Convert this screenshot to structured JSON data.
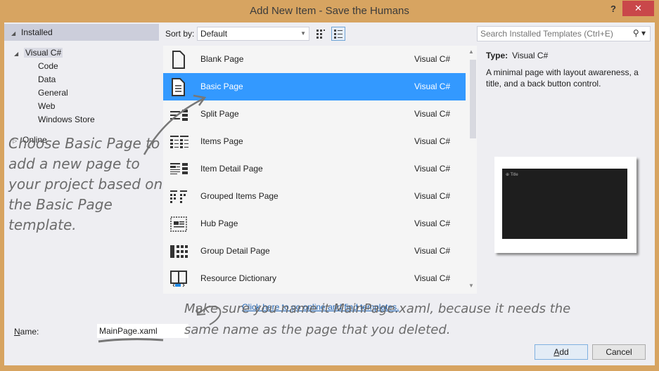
{
  "window": {
    "title": "Add New Item - Save the Humans",
    "help_label": "?",
    "close_label": "✕"
  },
  "tree": {
    "installed": "Installed",
    "visual_csharp": "Visual C#",
    "children": [
      "Code",
      "Data",
      "General",
      "Web",
      "Windows Store"
    ],
    "online": "Online"
  },
  "toolbar": {
    "sort_label": "Sort by:",
    "sort_value": "Default",
    "search_placeholder": "Search Installed Templates (Ctrl+E)"
  },
  "templates": [
    {
      "name": "Blank Page",
      "lang": "Visual C#",
      "icon": "blank-page-icon"
    },
    {
      "name": "Basic Page",
      "lang": "Visual C#",
      "icon": "basic-page-icon",
      "selected": true
    },
    {
      "name": "Split Page",
      "lang": "Visual C#",
      "icon": "split-page-icon"
    },
    {
      "name": "Items Page",
      "lang": "Visual C#",
      "icon": "items-page-icon"
    },
    {
      "name": "Item Detail Page",
      "lang": "Visual C#",
      "icon": "item-detail-page-icon"
    },
    {
      "name": "Grouped Items Page",
      "lang": "Visual C#",
      "icon": "grouped-items-page-icon"
    },
    {
      "name": "Hub Page",
      "lang": "Visual C#",
      "icon": "hub-page-icon"
    },
    {
      "name": "Group Detail Page",
      "lang": "Visual C#",
      "icon": "group-detail-page-icon"
    },
    {
      "name": "Resource Dictionary",
      "lang": "Visual C#",
      "icon": "resource-dictionary-icon"
    }
  ],
  "details": {
    "type_label": "Type:",
    "type_value": "Visual C#",
    "description": "A minimal page with layout awareness, a title, and a back button control.",
    "preview_title": "Title"
  },
  "online_link": "Click here to go online and find templates.",
  "name_field": {
    "label_accel": "N",
    "label_rest": "ame:",
    "value": "MainPage.xaml"
  },
  "buttons": {
    "add_accel": "A",
    "add_rest": "dd",
    "cancel": "Cancel"
  },
  "annotations": {
    "choose_note": "Choose Basic Page to add a new page to your project based on the Basic Page template.",
    "name_note": "Make sure you name it MainPage.xaml, because it needs the same name as the page that you deleted."
  }
}
